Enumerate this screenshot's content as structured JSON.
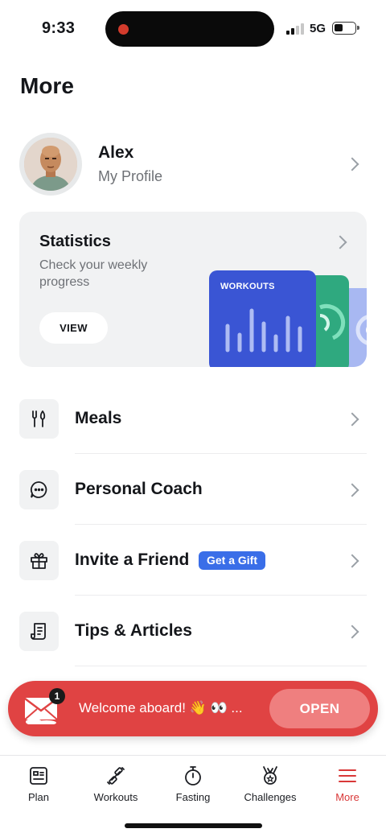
{
  "status_bar": {
    "time": "9:33",
    "network": "5G"
  },
  "page": {
    "title": "More"
  },
  "profile": {
    "name": "Alex",
    "subtitle": "My Profile"
  },
  "statistics": {
    "title": "Statistics",
    "subtitle": "Check your weekly progress",
    "view_label": "VIEW",
    "card_label": "WORKOUTS",
    "accent_colors": {
      "workouts": "#3a55d4",
      "secondary": "#2fa97f",
      "tertiary": "#a8b8f2"
    }
  },
  "menu": [
    {
      "label": "Meals",
      "icon": "utensils-icon"
    },
    {
      "label": "Personal Coach",
      "icon": "chat-bubble-icon"
    },
    {
      "label": "Invite a Friend",
      "icon": "gift-icon",
      "badge": "Get a Gift"
    },
    {
      "label": "Tips & Articles",
      "icon": "article-icon"
    }
  ],
  "banner": {
    "message": "Welcome aboard! 👋 👀 ...",
    "button": "OPEN",
    "unread_count": "1",
    "color": "#e04343"
  },
  "tabs": [
    {
      "label": "Plan",
      "icon": "plan-icon"
    },
    {
      "label": "Workouts",
      "icon": "dumbbell-icon"
    },
    {
      "label": "Fasting",
      "icon": "stopwatch-icon"
    },
    {
      "label": "Challenges",
      "icon": "medal-icon"
    },
    {
      "label": "More",
      "icon": "menu-icon",
      "active": true
    }
  ],
  "theme": {
    "active_tab": "#d93838",
    "badge_blue": "#3a6ee8"
  }
}
